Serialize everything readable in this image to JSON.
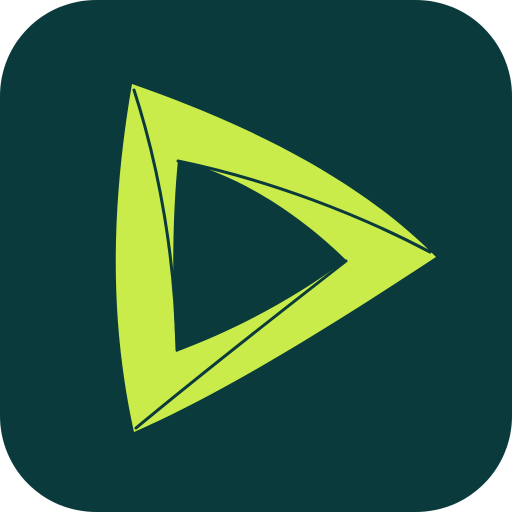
{
  "app_icon": {
    "icon_name": "play-triangle-logo-icon",
    "colors": {
      "background": "#0a3a3b",
      "logo": "#c9ec4b",
      "cut": "#0a3a3b"
    }
  }
}
